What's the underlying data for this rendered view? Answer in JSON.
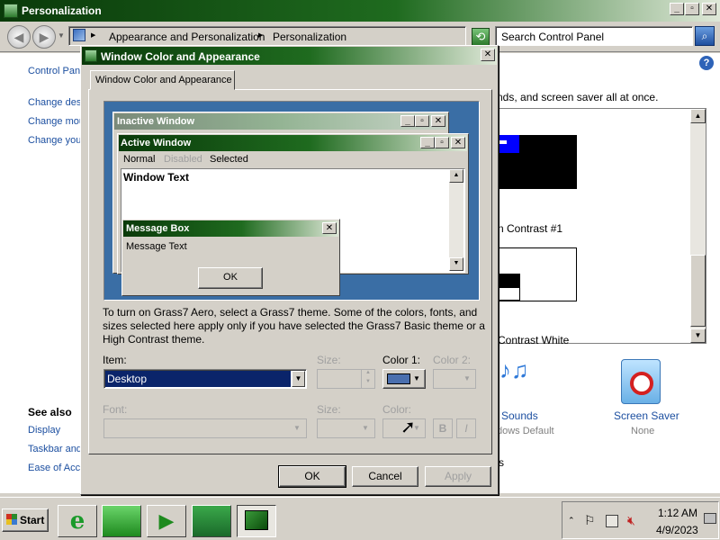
{
  "cp_window": {
    "title": "Personalization",
    "breadcrumb": [
      "Appearance and Personalization",
      "Personalization"
    ],
    "search_placeholder": "Search Control Panel",
    "left_links": [
      "Control Pan",
      "Change des",
      "Change mou",
      "Change you"
    ],
    "see_also_title": "See also",
    "see_also_links": [
      "Display",
      "Taskbar and",
      "Ease of Acc"
    ],
    "description_fragment": "nds, and screen saver all at once.",
    "theme1_label": "n Contrast #1",
    "theme2_label": "Contrast White",
    "sounds_label": "Sounds",
    "sounds_sub": "dows Default",
    "screensaver_label": "Screen Saver",
    "screensaver_sub": "None",
    "stray_char": "s"
  },
  "dialog": {
    "title": "Window Color and Appearance",
    "tab": "Window Color and Appearance",
    "preview": {
      "inactive_title": "Inactive Window",
      "active_title": "Active Window",
      "menu": [
        "Normal",
        "Disabled",
        "Selected"
      ],
      "window_text": "Window Text",
      "msgbox_title": "Message Box",
      "msgbox_text": "Message Text",
      "msgbox_ok": "OK"
    },
    "info": "To turn on Grass7 Aero, select a Grass7 theme.  Some of the colors, fonts, and sizes selected here apply only if you have selected the Grass7 Basic theme or a High Contrast theme.",
    "item_label": "Item:",
    "item_value": "Desktop",
    "size_label": "Size:",
    "color1_label": "Color 1:",
    "color2_label": "Color 2:",
    "color1_value": "#4a6fae",
    "font_label": "Font:",
    "font_size_label": "Size:",
    "font_color_label": "Color:",
    "bold_label": "B",
    "italic_label": "I",
    "ok": "OK",
    "cancel": "Cancel",
    "apply": "Apply"
  },
  "taskbar": {
    "start": "Start",
    "time": "1:12 AM",
    "date": "4/9/2023"
  },
  "colors": {
    "titlebar_dark": "#0a3a0a",
    "titlebar_mid": "#1f6b1f",
    "desktop_preview": "#3a6ea5",
    "selection": "#0a246a",
    "link": "#1c4fa0"
  }
}
